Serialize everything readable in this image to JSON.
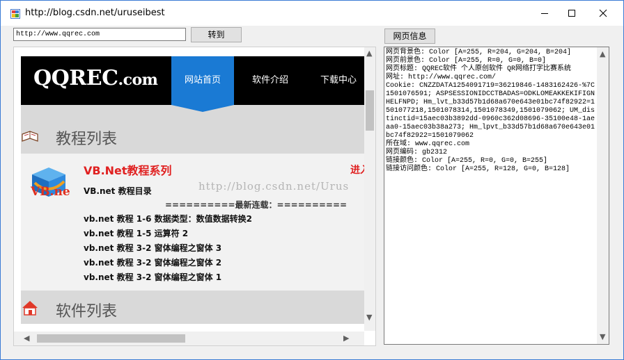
{
  "window": {
    "title": "http://blog.csdn.net/uruseibest"
  },
  "toolbar": {
    "url_value": "http://www.qqrec.com",
    "go_label": "转到",
    "info_label": "网页信息"
  },
  "site": {
    "logo_main": "QQREC",
    "logo_suffix": ".com",
    "nav": [
      "网站首页",
      "软件介绍",
      "下载中心"
    ],
    "sections": {
      "tutorials": "教程列表",
      "software": "软件列表"
    },
    "vb": {
      "title": "VB.Net教程系列",
      "side_text": "进入",
      "subtitle": "VB.net 教程目录",
      "latest": "==========最新连载：==========",
      "items": [
        "vb.net 教程 1-6 数据类型：数值数据转换2",
        "vb.net 教程 1-5 运算符 2",
        "vb.net 教程 3-2 窗体编程之窗体 3",
        "vb.net 教程 3-2 窗体编程之窗体 2",
        "vb.net 教程 3-2 窗体编程之窗体 1"
      ]
    },
    "watermark": "http://blog.csdn.net/Urus"
  },
  "info": {
    "text": "网页背景色: Color [A=255, R=204, G=204, B=204]\n网页前景色: Color [A=255, R=0, G=0, B=0]\n网页标题: QQREC软件 个人原创软件 QR网络打字比赛系统\n网址: http://www.qqrec.com/\nCookie: CNZZDATA1254091719=36219846-1483162426-%7C1501076591; ASPSESSIONIDCCTBADAS=ODKLOMEAKKEKIFIGNHELFNPD; Hm_lvt_b33d57b1d68a670e643e01bc74f82922=1501077218,1501078314,1501078349,1501079062; UM_distinctid=15aec03b3892dd-0960c362d08696-35100e48-1aeaa0-15aec03b38a273; Hm_lpvt_b33d57b1d68a670e643e01bc74f82922=1501079062\n所在域: www.qqrec.com\n网页编码: gb2312\n链接颜色: Color [A=255, R=0, G=0, B=255]\n链接访问颜色: Color [A=255, R=128, G=0, B=128]"
  },
  "colors": {
    "nav_active": "#1a7ad4",
    "accent_red": "#e02020",
    "header_bg": "#000000"
  }
}
